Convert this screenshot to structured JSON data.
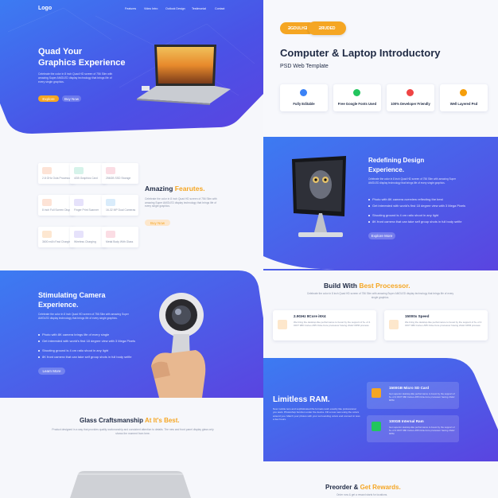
{
  "colors": {
    "accent": "#f5a623",
    "primary": "#3b5fe8",
    "dark": "#1f2a44"
  },
  "nav": {
    "logo": "Logo",
    "items": [
      "Features",
      "Video Intro",
      "Outlook Design",
      "Testimonial",
      "Contact"
    ]
  },
  "hero": {
    "title_line1": "Quad Your",
    "title_line2": "Graphics Experience",
    "body": "Celebrate the color in 8 inch Quad HD screen of 756 Slim with amazing Super AMOLED display technology that brings life of every single graphics.",
    "btn_primary": "Explore",
    "btn_secondary": "Buy Now"
  },
  "features": {
    "title_a": "Amazing ",
    "title_b": "Fearutes.",
    "body": "Celebrate the color in 8 inch Quad HD screen of 756 Slim with amazing Super AMOLED display technology that brings life of every single graphics.",
    "cta": "Buy Now",
    "items": [
      {
        "label": "2.8 GHz Octa Processor",
        "icon": "chip-icon",
        "color": "#fde3d6"
      },
      {
        "label": "4GB Graphics Card",
        "icon": "card-icon",
        "color": "#d6f3ea"
      },
      {
        "label": "256GB SSD Storage",
        "icon": "storage-icon",
        "color": "#fbdde4"
      },
      {
        "label": "8 inch Full Screen Display",
        "icon": "display-icon",
        "color": "#fde3d6"
      },
      {
        "label": "Finger Print Scanner",
        "icon": "fingerprint-icon",
        "color": "#e6e2fb"
      },
      {
        "label": "16-32 MP Dual Cameras",
        "icon": "camera-icon",
        "color": "#d9ecfb"
      },
      {
        "label": "3600 mAh Fast Charging",
        "icon": "battery-icon",
        "color": "#fde7d1"
      },
      {
        "label": "Wireless Charging",
        "icon": "wireless-icon",
        "color": "#e6e2fb"
      },
      {
        "label": "Metal Body With Glass",
        "icon": "metal-icon",
        "color": "#fbdde4"
      }
    ]
  },
  "camera": {
    "title_line1": "Stimulating Camera",
    "title_line2": "Experience.",
    "body": "Celebrate the color in 8 inch Quad HD screen of 756 Slim with amazing Super AMOLED display technology that brings life of every single graphics.",
    "bullets": [
      "Photo with 8K camera brings life of every single",
      "Get interested with world's first 18 degree view with 3 Mega Pixels",
      "Shooting ground is 4 cm ratio shoot in any light",
      "8K front camera that can take self group shots in full body selfie"
    ],
    "cta": "Learn More"
  },
  "glass": {
    "title_a": "Glass Craftsmanship ",
    "title_b": "At It's Best.",
    "body": "Product designed in a way that provides quality workmanship and consistent attention to details. The new and front panel display glass only shows the moment from here."
  },
  "promo": {
    "badge_left": "ƎGDULHƎ",
    "badge_right": "ƎЯUDED",
    "title": "Computer & Laptop Introductory",
    "subtitle": "PSD Web Template",
    "highlights": [
      {
        "label": "Fully Editable",
        "icon": "edit-icon",
        "color": "#3b82f6"
      },
      {
        "label": "Free Google Fonts Used",
        "icon": "font-icon",
        "color": "#22c55e"
      },
      {
        "label": "100% Developer Friendly",
        "icon": "code-icon",
        "color": "#ef4444"
      },
      {
        "label": "Well Layered Psd",
        "icon": "layers-icon",
        "color": "#f59e0b"
      }
    ]
  },
  "design": {
    "title_line1": "Redefining Design",
    "title_line2": "Experience.",
    "body": "Celebrate the color in 8 inch Quad HD screen of 756 Slim with amazing Super AMOLED display technology that brings life of every single graphics.",
    "bullets": [
      "Photo with 8K camera overview reflecting the best",
      "Get interested with world's first 18 degree view with 3 Mega Pixels",
      "Shooting ground is 4 cm ratio shoot in any light",
      "8K front camera that can take self group shots in full body selfie"
    ],
    "cta": "Explore More"
  },
  "processor": {
    "title_a": "Build With ",
    "title_b": "Best Processor.",
    "body": "Celebrate the color in 8 inch Quad HD screen of 756 Slim with amazing Super AMOLED display technology that brings life of every single graphics.",
    "cards": [
      {
        "title": "2.9GHz 8Core i9X4",
        "body": "We bring the desktop-like performance to boost by the support of 6+ of 4 OKIT 980 Cortex-A55 Octa-Core processor having 2GHz RPM process.",
        "icon": "cpu-icon"
      },
      {
        "title": "15000x Speed",
        "body": "We bring the desktop-like performance to boost by the support of 6+ of 4 OKIT 980 Cortex-A55 Octa-Core processor having 2GHz RPM process.",
        "icon": "speed-icon"
      }
    ]
  },
  "ram": {
    "title": "Limitless RAM.",
    "body": "Now mobile lens and sophisticated file formats work exactly like professional you want. Photoshop function under the device. Fill a new new using the colors around you. Match your photos with your surrounding colors and connect in less a few hours.",
    "cards": [
      {
        "title": "1500GB Micro SD Card",
        "body": "Get superior desktop-like performance to boost by the support of 6+ of 4 OKIT 980 Cortex-A55 Octa-Core processor having 2GHz RPM.",
        "icon": "sd-card-icon",
        "color": "#f5a623"
      },
      {
        "title": "100GB Internal Ram",
        "body": "Get superior desktop-like performance to boost by the support of 6+ of 4 OKIT 980 Cortex-A55 Octa-Core processor having 2GHz RPM.",
        "icon": "ram-icon",
        "color": "#22c55e"
      }
    ]
  },
  "preorder": {
    "title_a": "Preorder & ",
    "title_b": "Get Rewards.",
    "body": "Order now & get a reward starts for locations."
  }
}
